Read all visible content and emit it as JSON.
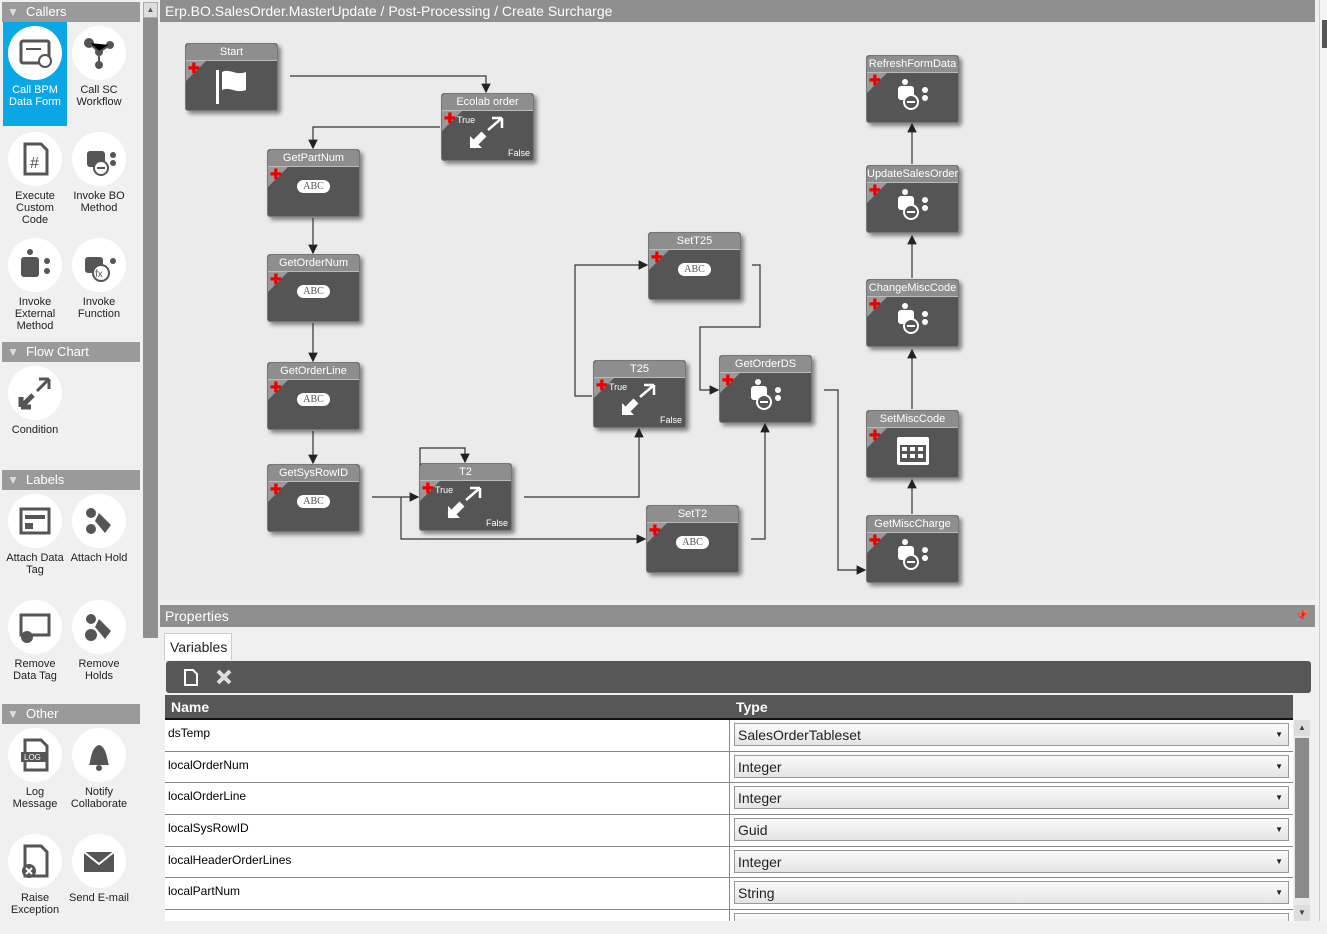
{
  "sidebar": {
    "sections": [
      {
        "title": "Callers",
        "items": [
          {
            "label": "Call BPM Data Form",
            "icon": "form-icon",
            "selected": true
          },
          {
            "label": "Call SC Workflow",
            "icon": "workflow-icon"
          },
          {
            "label": "Execute Custom Code",
            "icon": "code-file-icon"
          },
          {
            "label": "Invoke BO Method",
            "icon": "bo-method-icon"
          },
          {
            "label": "Invoke External Method",
            "icon": "external-method-icon"
          },
          {
            "label": "Invoke Function",
            "icon": "function-icon"
          }
        ]
      },
      {
        "title": "Flow Chart",
        "items": [
          {
            "label": "Condition",
            "icon": "condition-icon"
          }
        ]
      },
      {
        "title": "Labels",
        "items": [
          {
            "label": "Attach Data Tag",
            "icon": "data-tag-icon"
          },
          {
            "label": "Attach Hold",
            "icon": "hold-icon"
          },
          {
            "label": "Remove Data Tag",
            "icon": "remove-data-tag-icon"
          },
          {
            "label": "Remove Holds",
            "icon": "remove-hold-icon"
          }
        ]
      },
      {
        "title": "Other",
        "items": [
          {
            "label": "Log Message",
            "icon": "log-icon"
          },
          {
            "label": "Notify Collaborate",
            "icon": "bell-icon"
          },
          {
            "label": "Raise Exception",
            "icon": "exception-icon"
          },
          {
            "label": "Send E-mail",
            "icon": "email-icon"
          }
        ]
      }
    ]
  },
  "title": "Erp.BO.SalesOrder.MasterUpdate / Post-Processing / Create Surcharge",
  "nodes": [
    {
      "label": "Start",
      "type": "start"
    },
    {
      "label": "Ecolab order",
      "type": "condition",
      "true_label": "True",
      "false_label": "False"
    },
    {
      "label": "GetPartNum",
      "type": "set",
      "icon_text": "ABC"
    },
    {
      "label": "GetOrderNum",
      "type": "set",
      "icon_text": "ABC"
    },
    {
      "label": "GetOrderLine",
      "type": "set",
      "icon_text": "ABC"
    },
    {
      "label": "GetSysRowID",
      "type": "set",
      "icon_text": "ABC"
    },
    {
      "label": "T2",
      "type": "condition",
      "true_label": "True",
      "false_label": "False"
    },
    {
      "label": "SetT2",
      "type": "set",
      "icon_text": "ABC"
    },
    {
      "label": "T25",
      "type": "condition",
      "true_label": "True",
      "false_label": "False"
    },
    {
      "label": "SetT25",
      "type": "set",
      "icon_text": "ABC"
    },
    {
      "label": "GetOrderDS",
      "type": "bo"
    },
    {
      "label": "RefreshFormData",
      "type": "bo"
    },
    {
      "label": "UpdateSalesOrder",
      "type": "bo"
    },
    {
      "label": "ChangeMiscCode",
      "type": "bo"
    },
    {
      "label": "SetMiscCode",
      "type": "calendar"
    },
    {
      "label": "GetMiscCharge",
      "type": "bo"
    }
  ],
  "properties": {
    "title": "Properties",
    "tab": "Variables",
    "columns": [
      "Name",
      "Type"
    ],
    "rows": [
      {
        "name": "dsTemp",
        "type": "SalesOrderTableset"
      },
      {
        "name": "localOrderNum",
        "type": "Integer"
      },
      {
        "name": "localOrderLine",
        "type": "Integer"
      },
      {
        "name": "localSysRowID",
        "type": "Guid"
      },
      {
        "name": "localHeaderOrderLines",
        "type": "Integer"
      },
      {
        "name": "localPartNum",
        "type": "String"
      },
      {
        "name": "",
        "type": ""
      }
    ]
  },
  "colors": {
    "selected": "#0aa7e6",
    "node": "#555555",
    "header": "#8f8f8f"
  }
}
